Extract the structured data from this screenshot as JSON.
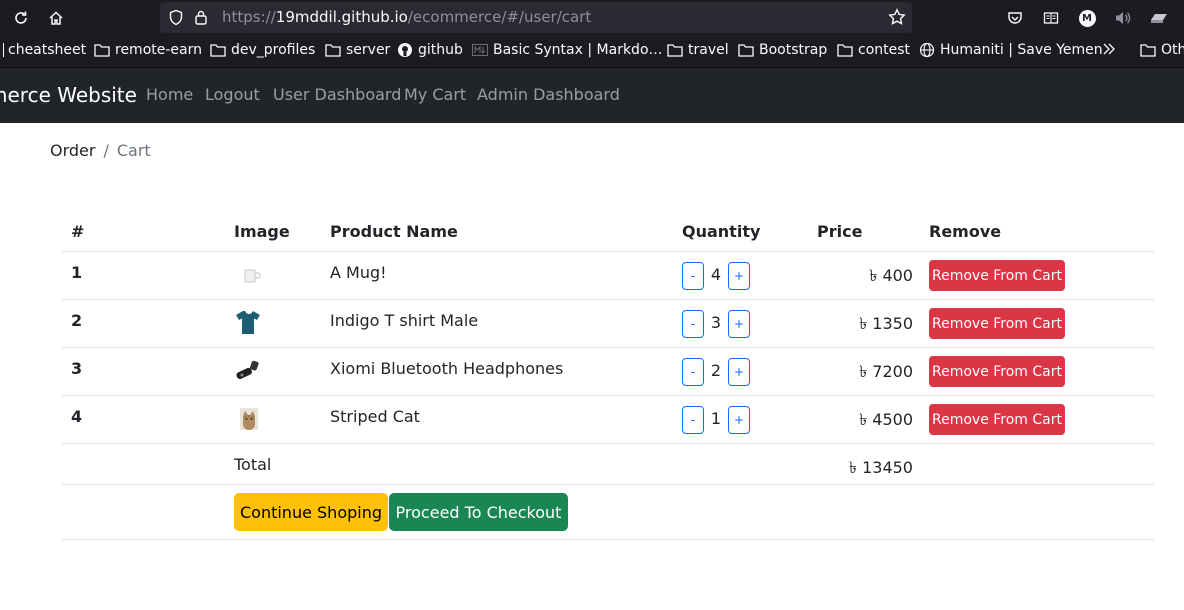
{
  "browser": {
    "url_prefix": "https://",
    "url_host": "19mddil.github.io",
    "url_path": "/ecommerce/#/user/cart",
    "bookmarks": [
      "cheatsheet",
      "remote-earn",
      "dev_profiles",
      "server",
      "github",
      "Basic Syntax | Markdo…",
      "travel",
      "Bootstrap",
      "contest",
      "Humaniti | Save Yemen",
      "Oth"
    ],
    "profile_initial": "M"
  },
  "navbar": {
    "brand": "merce Website",
    "links": [
      "Home",
      "Logout",
      "User Dashboard",
      "My Cart",
      "Admin Dashboard"
    ]
  },
  "breadcrumb": {
    "items": [
      "Order",
      "Cart"
    ],
    "separator": "/"
  },
  "table": {
    "headers": [
      "#",
      "Image",
      "Product Name",
      "Quantity",
      "Price",
      "Remove"
    ],
    "rows": [
      {
        "index": "1",
        "image": "mug-image",
        "name": "A Mug!",
        "quantity": "4",
        "price": "৳ 400",
        "remove": "Remove From Cart"
      },
      {
        "index": "2",
        "image": "tshirt-image",
        "name": "Indigo T shirt Male",
        "quantity": "3",
        "price": "৳ 1350",
        "remove": "Remove From Cart"
      },
      {
        "index": "3",
        "image": "headphones-image",
        "name": "Xiomi Bluetooth Headphones",
        "quantity": "2",
        "price": "৳ 7200",
        "remove": "Remove From Cart"
      },
      {
        "index": "4",
        "image": "cat-image",
        "name": "Striped Cat",
        "quantity": "1",
        "price": "৳ 4500",
        "remove": "Remove From Cart"
      }
    ],
    "minus_label": "-",
    "plus_label": "+",
    "total_label": "Total",
    "total_value": "৳ 13450"
  },
  "actions": {
    "continue_label": "Continue Shoping",
    "checkout_label": "Proceed To Checkout"
  },
  "colors": {
    "danger": "#dc3545",
    "warning": "#ffc107",
    "success": "#198754",
    "primary": "#0d6efd",
    "navbar": "#212529"
  }
}
